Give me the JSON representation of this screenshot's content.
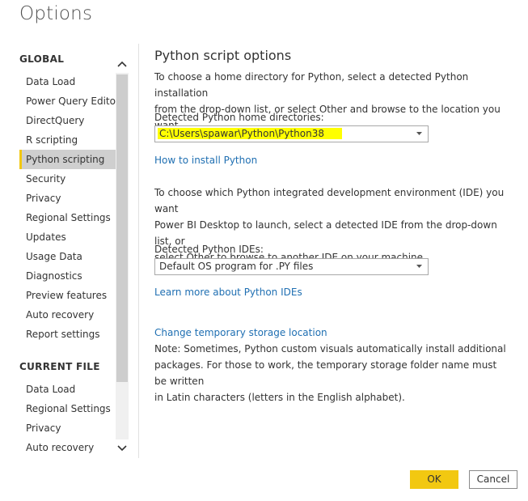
{
  "window": {
    "title": "Options"
  },
  "sidebar": {
    "global_heading": "GLOBAL",
    "global_items": [
      {
        "label": "Data Load"
      },
      {
        "label": "Power Query Editor"
      },
      {
        "label": "DirectQuery"
      },
      {
        "label": "R scripting"
      },
      {
        "label": "Python scripting",
        "selected": true
      },
      {
        "label": "Security"
      },
      {
        "label": "Privacy"
      },
      {
        "label": "Regional Settings"
      },
      {
        "label": "Updates"
      },
      {
        "label": "Usage Data"
      },
      {
        "label": "Diagnostics"
      },
      {
        "label": "Preview features"
      },
      {
        "label": "Auto recovery"
      },
      {
        "label": "Report settings"
      }
    ],
    "current_file_heading": "CURRENT FILE",
    "current_file_items": [
      {
        "label": "Data Load"
      },
      {
        "label": "Regional Settings"
      },
      {
        "label": "Privacy"
      },
      {
        "label": "Auto recovery"
      }
    ],
    "scroll_up_icon": "chevron-up-icon",
    "scroll_down_icon": "chevron-down-icon"
  },
  "main": {
    "title": "Python script options",
    "home_intro_line1": "To choose a home directory for Python, select a detected Python installation",
    "home_intro_line2": "from the drop-down list, or select Other and browse to the location you want.",
    "home_dirs_label": "Detected Python home directories:",
    "home_dir_value": "C:\\Users\\spawar\\Python\\Python38",
    "install_link": "How to install Python",
    "ide_intro_line1": "To choose which Python integrated development environment (IDE) you want",
    "ide_intro_line2": "Power BI Desktop to launch, select a detected IDE from the drop-down list, or",
    "ide_intro_line3": "select Other to browse to another IDE on your machine.",
    "ide_label": "Detected Python IDEs:",
    "ide_value": "Default OS program for .PY files",
    "ide_link": "Learn more about Python IDEs",
    "storage_link": "Change temporary storage location",
    "storage_note_line1": "Note: Sometimes, Python custom visuals automatically install additional",
    "storage_note_line2": "packages. For those to work, the temporary storage folder name must be written",
    "storage_note_line3": "in Latin characters (letters in the English alphabet)."
  },
  "buttons": {
    "ok": "OK",
    "cancel": "Cancel"
  },
  "colors": {
    "accent": "#f2c811",
    "link": "#1f6fb2",
    "highlight": "#ffff00",
    "selected_bg": "#cfcfcf"
  }
}
